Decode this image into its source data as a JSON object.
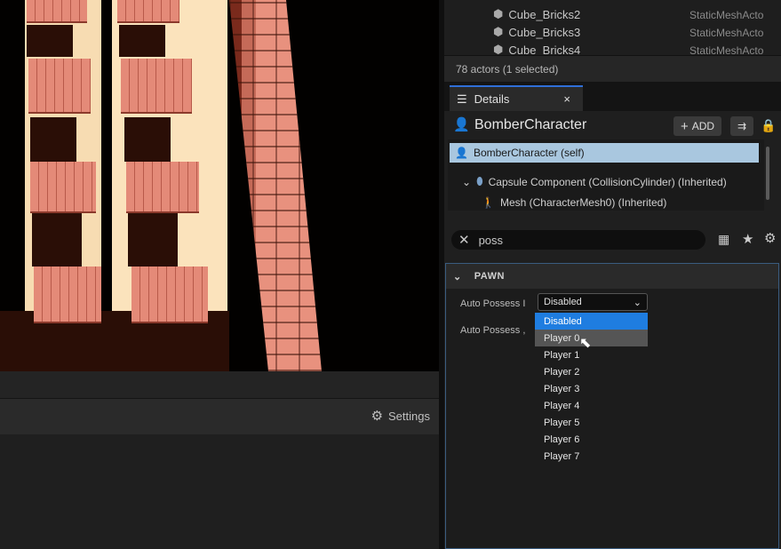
{
  "outliner": {
    "rows": [
      {
        "name": "Cube_Bricks2",
        "type": "StaticMeshActo"
      },
      {
        "name": "Cube_Bricks3",
        "type": "StaticMeshActo"
      },
      {
        "name": "Cube_Bricks4",
        "type": "StaticMeshActo"
      }
    ],
    "actor_count": "78 actors (1 selected)"
  },
  "viewport": {
    "settings_label": "Settings"
  },
  "details": {
    "tab_label": "Details",
    "tab_close": "×",
    "title": "BomberCharacter",
    "add_label": "ADD",
    "components": {
      "self": "BomberCharacter (self)",
      "capsule": "Capsule Component (CollisionCylinder) (Inherited)",
      "mesh": "Mesh (CharacterMesh0) (Inherited)"
    },
    "search_value": "poss",
    "section": "PAWN",
    "props": {
      "auto_possess_player_label": "Auto Possess I",
      "auto_possess_player_value": "Disabled",
      "auto_possess_ai_label": "Auto Possess ,"
    },
    "dropdown_options": [
      "Disabled",
      "Player 0",
      "Player 1",
      "Player 2",
      "Player 3",
      "Player 4",
      "Player 5",
      "Player 6",
      "Player 7"
    ]
  },
  "colors": {
    "accent": "#1f7de0",
    "selection": "#a9c7df"
  }
}
